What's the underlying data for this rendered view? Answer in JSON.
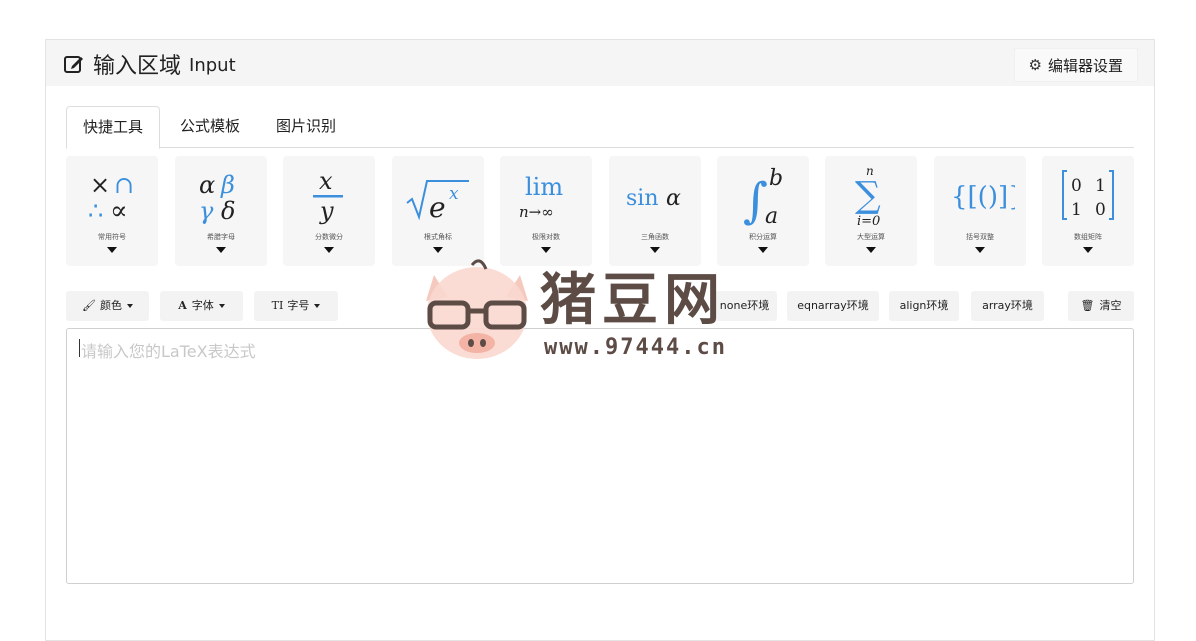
{
  "header": {
    "title": "输入区域",
    "subtitle": "Input",
    "settings_label": "编辑器设置"
  },
  "tabs": [
    {
      "label": "快捷工具",
      "active": true
    },
    {
      "label": "公式模板",
      "active": false
    },
    {
      "label": "图片识别",
      "active": false
    }
  ],
  "tools": [
    {
      "label": "常用符号",
      "icon": "common-symbols-icon"
    },
    {
      "label": "希腊字母",
      "icon": "greek-letters-icon"
    },
    {
      "label": "分数微分",
      "icon": "fraction-icon"
    },
    {
      "label": "根式角标",
      "icon": "radical-icon"
    },
    {
      "label": "极限对数",
      "icon": "limit-icon"
    },
    {
      "label": "三角函数",
      "icon": "trig-icon"
    },
    {
      "label": "积分运算",
      "icon": "integral-icon"
    },
    {
      "label": "大型运算",
      "icon": "sum-icon"
    },
    {
      "label": "括号双整",
      "icon": "bracket-icon"
    },
    {
      "label": "数组矩阵",
      "icon": "matrix-icon"
    }
  ],
  "format_buttons": {
    "color": "颜色",
    "font": "字体",
    "size": "字号"
  },
  "env_buttons": {
    "none": "none环境",
    "eqnarray": "eqnarray环境",
    "align": "align环境",
    "array": "array环境"
  },
  "clear_label": "清空",
  "editor": {
    "placeholder": "请输入您的LaTeX表达式",
    "value": ""
  },
  "watermark": {
    "text": "猪豆网",
    "url": "www.97444.cn"
  },
  "colors": {
    "accent_blue": "#3b8fdd",
    "panel_header": "#f5f5f5",
    "tool_bg": "#f6f6f6"
  }
}
